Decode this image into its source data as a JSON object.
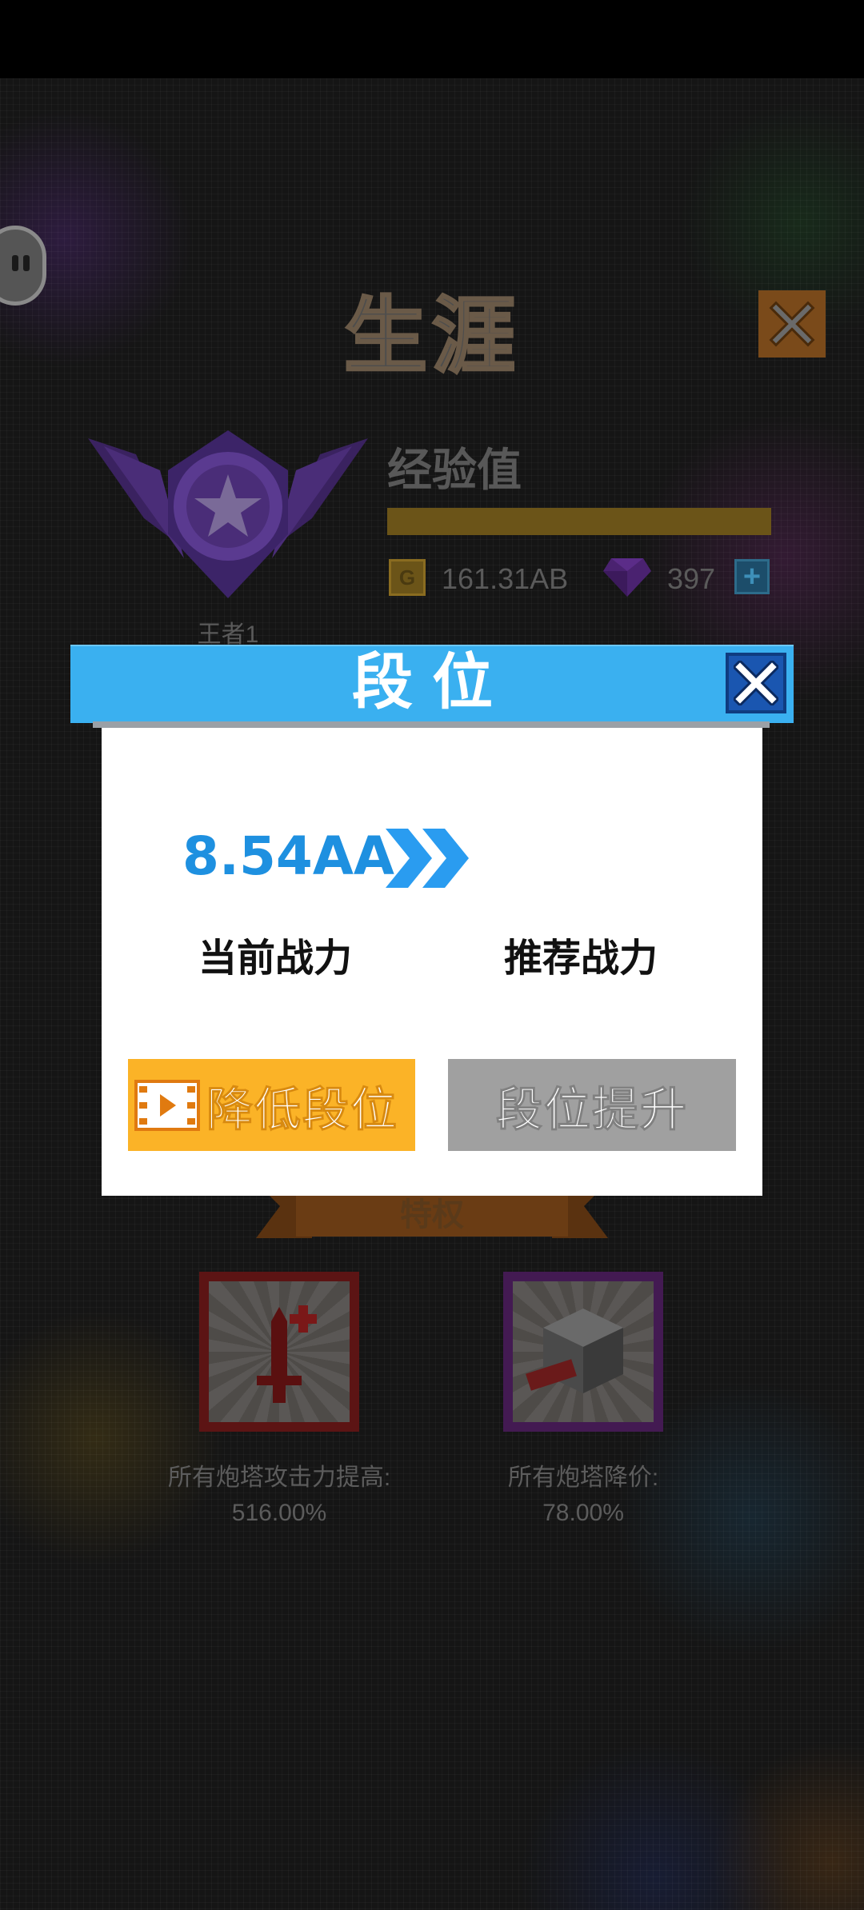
{
  "background": {
    "title": "生涯",
    "rank_label": "王者1",
    "xp_label": "经验值",
    "coins": "161.31AB",
    "gems": "397",
    "add_symbol": "+",
    "coin_glyph": "G",
    "perks_ribbon": "特权",
    "perks": [
      {
        "icon": "sword-plus-icon",
        "line1": "所有炮塔攻击力提高:",
        "line2": "516.00%"
      },
      {
        "icon": "sale-cube-icon",
        "line1": "所有炮塔降价:",
        "line2": "78.00%"
      }
    ]
  },
  "modal": {
    "title": "段位",
    "current_power": "8.54AA",
    "current_power_label": "当前战力",
    "recommended_power_label": "推荐战力",
    "lower_button": "降低段位",
    "raise_button": "段位提升"
  },
  "colors": {
    "modal_header": "#3ab0f0",
    "close_button": "#1a56b0",
    "power_value": "#1e90e0",
    "lower_button": "#fbb327",
    "raise_button": "#a0a0a0"
  }
}
